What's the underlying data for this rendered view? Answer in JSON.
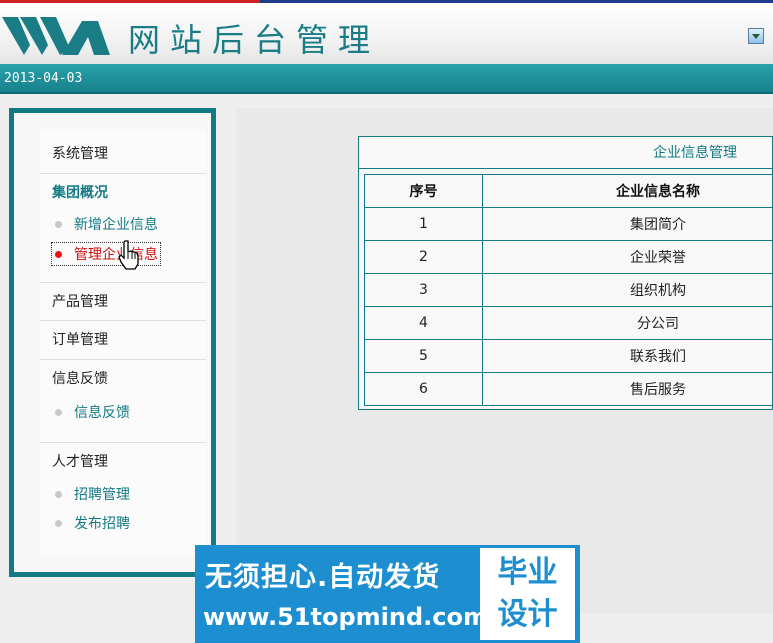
{
  "header": {
    "logo_icon": "wm-logo-icon",
    "title": "网站后台管理",
    "right_icon": "download-icon"
  },
  "datebar": {
    "date": "2013-04-03"
  },
  "sidebar": {
    "sections": [
      {
        "label": "系统管理",
        "active": false
      },
      {
        "label": "集团概况",
        "active": true
      },
      {
        "label": "产品管理",
        "active": false
      },
      {
        "label": "订单管理",
        "active": false
      },
      {
        "label": "信息反馈",
        "active": false
      },
      {
        "label": "人才管理",
        "active": false
      }
    ],
    "group_items": [
      {
        "label": "新增企业信息",
        "current": false
      },
      {
        "label": "管理企业信息",
        "current": true
      }
    ],
    "feedback_items": [
      {
        "label": "信息反馈"
      }
    ],
    "talent_items": [
      {
        "label": "招聘管理"
      },
      {
        "label": "发布招聘"
      }
    ]
  },
  "table": {
    "title": "企业信息管理",
    "headers": [
      "序号",
      "企业信息名称"
    ],
    "rows": [
      [
        "1",
        "集团简介"
      ],
      [
        "2",
        "企业荣誉"
      ],
      [
        "3",
        "组织机构"
      ],
      [
        "4",
        "分公司"
      ],
      [
        "5",
        "联系我们"
      ],
      [
        "6",
        "售后服务"
      ]
    ]
  },
  "watermark": {
    "line1": "无须担心.自动发货",
    "line2": "www.51topmind.com",
    "badge_line1": "毕业",
    "badge_line2": "设计"
  }
}
